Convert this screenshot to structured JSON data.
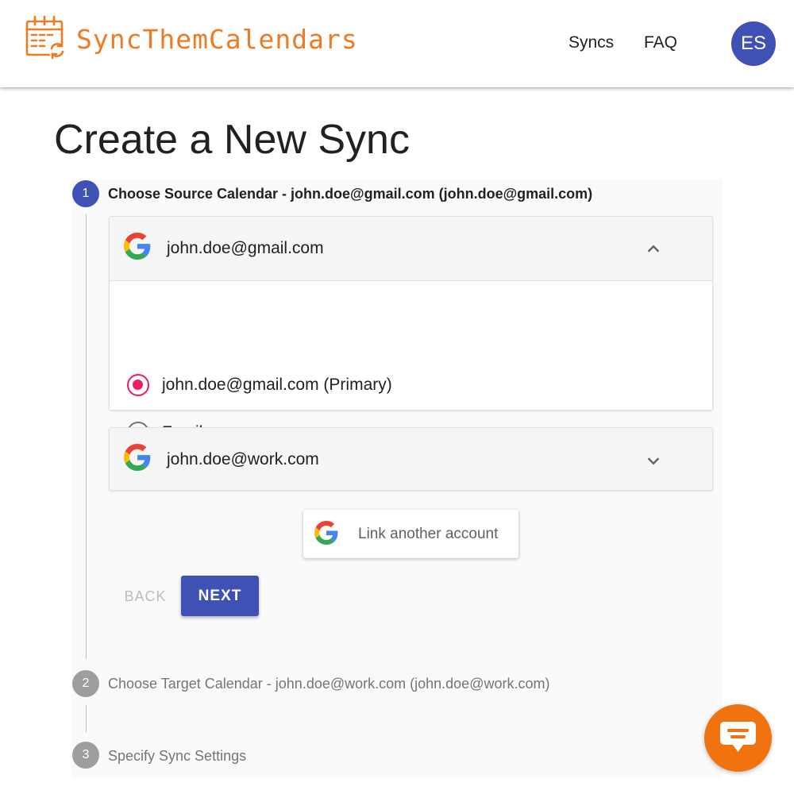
{
  "header": {
    "brand": "SyncThemCalendars",
    "logo_icon": "calendar-sync-icon",
    "nav": {
      "syncs": "Syncs",
      "faq": "FAQ"
    },
    "avatar_initials": "ES",
    "brand_color": "#ef7a24",
    "avatar_color": "#3f51b5"
  },
  "page": {
    "title": "Create a New Sync"
  },
  "stepper": {
    "steps": [
      {
        "number": "1",
        "label": "Choose Source Calendar - john.doe@gmail.com (john.doe@gmail.com)",
        "state": "active"
      },
      {
        "number": "2",
        "label": "Choose Target Calendar - john.doe@work.com (john.doe@work.com)",
        "state": "inactive"
      },
      {
        "number": "3",
        "label": "Specify Sync Settings",
        "state": "inactive"
      }
    ],
    "active_color": "#3f51b5",
    "inactive_color": "#9e9e9e"
  },
  "accounts": [
    {
      "email": "john.doe@gmail.com",
      "icon": "google-icon",
      "expanded": true,
      "expand_icon": "chevron-up-icon",
      "calendars": [
        {
          "label": "john.doe@gmail.com (Primary)",
          "checked": true
        },
        {
          "label": "Family",
          "checked": false
        }
      ]
    },
    {
      "email": "john.doe@work.com",
      "icon": "google-icon",
      "expanded": false,
      "expand_icon": "chevron-down-icon"
    }
  ],
  "actions": {
    "link_account": "Link another account",
    "back": "BACK",
    "next": "NEXT"
  },
  "selection_color": "#e91e63",
  "chat": {
    "icon": "chat-icon",
    "color": "#f0730f"
  }
}
